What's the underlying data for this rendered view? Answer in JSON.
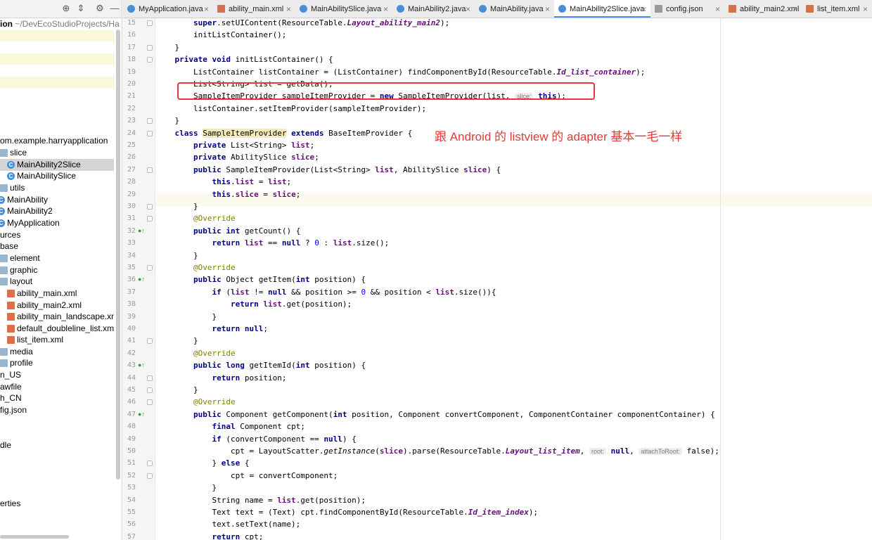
{
  "project_panel": {
    "breadcrumb_bold": "ion",
    "breadcrumb_path": "~/DevEcoStudioProjects/Ha",
    "toolbar_icons": [
      "target-icon",
      "collapse-icon",
      "gear-icon",
      "minimize-icon"
    ],
    "items": [
      {
        "label": "om.example.harryapplication",
        "icon": "none",
        "selected": false
      },
      {
        "label": "slice",
        "icon": "folder",
        "selected": false
      },
      {
        "label": "MainAbility2Slice",
        "icon": "class",
        "selected": true
      },
      {
        "label": "MainAbilitySlice",
        "icon": "class",
        "selected": false
      },
      {
        "label": "utils",
        "icon": "folder",
        "selected": false
      },
      {
        "label": "MainAbility",
        "icon": "class",
        "selected": false
      },
      {
        "label": "MainAbility2",
        "icon": "class",
        "selected": false
      },
      {
        "label": "MyApplication",
        "icon": "class",
        "selected": false
      },
      {
        "label": "urces",
        "icon": "none",
        "selected": false
      },
      {
        "label": "base",
        "icon": "none",
        "selected": false
      },
      {
        "label": "element",
        "icon": "folder",
        "selected": false
      },
      {
        "label": "graphic",
        "icon": "folder",
        "selected": false
      },
      {
        "label": "layout",
        "icon": "folder",
        "selected": false
      },
      {
        "label": "ability_main.xml",
        "icon": "xml",
        "selected": false
      },
      {
        "label": "ability_main2.xml",
        "icon": "xml",
        "selected": false
      },
      {
        "label": "ability_main_landscape.xm",
        "icon": "xml",
        "selected": false
      },
      {
        "label": "default_doubleline_list.xml",
        "icon": "xml",
        "selected": false
      },
      {
        "label": "list_item.xml",
        "icon": "xml",
        "selected": false
      },
      {
        "label": "media",
        "icon": "folder",
        "selected": false
      },
      {
        "label": "profile",
        "icon": "folder",
        "selected": false
      },
      {
        "label": "n_US",
        "icon": "none",
        "selected": false
      },
      {
        "label": "awfile",
        "icon": "none",
        "selected": false
      },
      {
        "label": "h_CN",
        "icon": "none",
        "selected": false
      },
      {
        "label": "fig.json",
        "icon": "none",
        "selected": false
      },
      {
        "label": "dle",
        "icon": "none",
        "selected": false
      },
      {
        "label": "erties",
        "icon": "none",
        "selected": false
      }
    ]
  },
  "tabs": [
    {
      "label": "MyApplication.java",
      "icon": "class",
      "active": false
    },
    {
      "label": "ability_main.xml",
      "icon": "xml",
      "active": false
    },
    {
      "label": "MainAbilitySlice.java",
      "icon": "class",
      "active": false
    },
    {
      "label": "MainAbility2.java",
      "icon": "class",
      "active": false
    },
    {
      "label": "MainAbility.java",
      "icon": "class",
      "active": false
    },
    {
      "label": "MainAbility2Slice.java",
      "icon": "class",
      "active": true
    },
    {
      "label": "config.json",
      "icon": "json",
      "active": false
    },
    {
      "label": "ability_main2.xml",
      "icon": "xml",
      "active": false
    },
    {
      "label": "list_item.xml",
      "icon": "xml",
      "active": false
    }
  ],
  "editor": {
    "line_numbers": [
      "15",
      "16",
      "17",
      "18",
      "19",
      "20",
      "21",
      "22",
      "23",
      "24",
      "25",
      "26",
      "27",
      "28",
      "29",
      "30",
      "31",
      "32",
      "33",
      "34",
      "35",
      "36",
      "37",
      "38",
      "39",
      "40",
      "41",
      "42",
      "43",
      "44",
      "45",
      "46",
      "47",
      "48",
      "49",
      "50",
      "51",
      "52",
      "53",
      "54",
      "55",
      "56",
      "57"
    ],
    "code_lines": [
      "        super.setUIContent(ResourceTable.Layout_ability_main2);",
      "        initListContainer();",
      "    }",
      "    private void initListContainer() {",
      "        ListContainer listContainer = (ListContainer) findComponentById(ResourceTable.Id_list_container);",
      "        List<String> list = getData();",
      "        SampleItemProvider sampleItemProvider = new SampleItemProvider(list, slice: this);",
      "        listContainer.setItemProvider(sampleItemProvider);",
      "    }",
      "    class SampleItemProvider extends BaseItemProvider {",
      "        private List<String> list;",
      "        private AbilitySlice slice;",
      "        public SampleItemProvider(List<String> list, AbilitySlice slice) {",
      "            this.list = list;",
      "            this.slice = slice;",
      "        }",
      "        @Override",
      "        public int getCount() {",
      "            return list == null ? 0 : list.size();",
      "        }",
      "        @Override",
      "        public Object getItem(int position) {",
      "            if (list != null && position >= 0 && position < list.size()){",
      "                return list.get(position);",
      "            }",
      "            return null;",
      "        }",
      "        @Override",
      "        public long getItemId(int position) {",
      "            return position;",
      "        }",
      "        @Override",
      "        public Component getComponent(int position, Component convertComponent, ComponentContainer componentContainer) {",
      "            final Component cpt;",
      "            if (convertComponent == null) {",
      "                cpt = LayoutScatter.getInstance(slice).parse(ResourceTable.Layout_list_item, root: null, attachToRoot: false);",
      "            } else {",
      "                cpt = convertComponent;",
      "            }",
      "            String name = list.get(position);",
      "            Text text = (Text) cpt.findComponentById(ResourceTable.Id_item_index);",
      "            text.setText(name);",
      "            return cpt;"
    ],
    "override_marker_lines": [
      "32",
      "36",
      "43",
      "47"
    ]
  },
  "annotation": {
    "text": "跟 Android 的 listview 的 adapter 基本一毛一样",
    "color": "#e53935"
  },
  "colors": {
    "keyword": "#000080",
    "number": "#0000ff",
    "field": "#660e7a",
    "annotation_code": "#808000",
    "active_tab": "#4b8ce8"
  }
}
